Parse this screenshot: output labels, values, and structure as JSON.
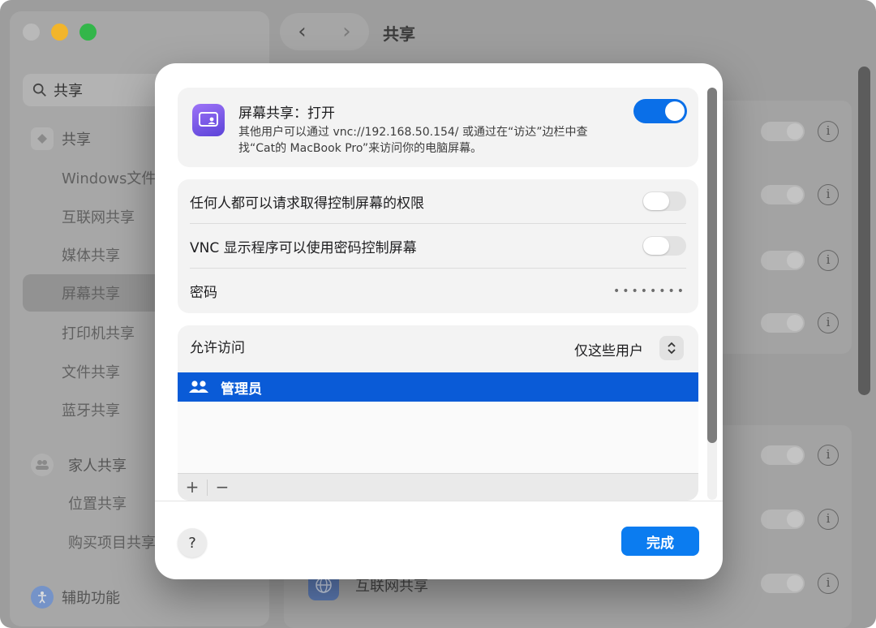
{
  "window": {
    "title": "共享",
    "nav": {
      "back": "‹",
      "forward": "›"
    }
  },
  "sidebar": {
    "search": {
      "value": "共享"
    },
    "items": [
      {
        "label": "共享"
      },
      {
        "label": "Windows文件"
      },
      {
        "label": "互联网共享"
      },
      {
        "label": "媒体共享"
      },
      {
        "label": "屏幕共享"
      },
      {
        "label": "打印机共享"
      },
      {
        "label": "文件共享"
      },
      {
        "label": "蓝牙共享"
      },
      {
        "label": "家人共享"
      },
      {
        "label": "位置共享"
      },
      {
        "label": "购买项目共享"
      },
      {
        "label": "辅助功能"
      }
    ]
  },
  "background": {
    "visible_row_label": "互联网共享",
    "info_glyph": "i"
  },
  "dialog": {
    "header": {
      "title": "屏幕共享：打开",
      "description": "其他用户可以通过 vnc://192.168.50.154/ 或通过在“访达”边栏中查找“Cat的 MacBook Pro”来访问你的电脑屏幕。",
      "enabled": true
    },
    "options": {
      "request_control": {
        "label": "任何人都可以请求取得控制屏幕的权限",
        "enabled": false
      },
      "vnc_password": {
        "label": "VNC 显示程序可以使用密码控制屏幕",
        "enabled": false
      },
      "password": {
        "label": "密码",
        "value": "••••••••"
      }
    },
    "access": {
      "label": "允许访问",
      "selected": "仅这些用户",
      "users": [
        {
          "name": "管理员"
        }
      ],
      "add_label": "+",
      "remove_label": "−"
    },
    "help_label": "?",
    "done_label": "完成"
  },
  "colors": {
    "accent": "#0a6fe8",
    "selection": "#0a5bd7",
    "done_button": "#0b7cf0"
  }
}
